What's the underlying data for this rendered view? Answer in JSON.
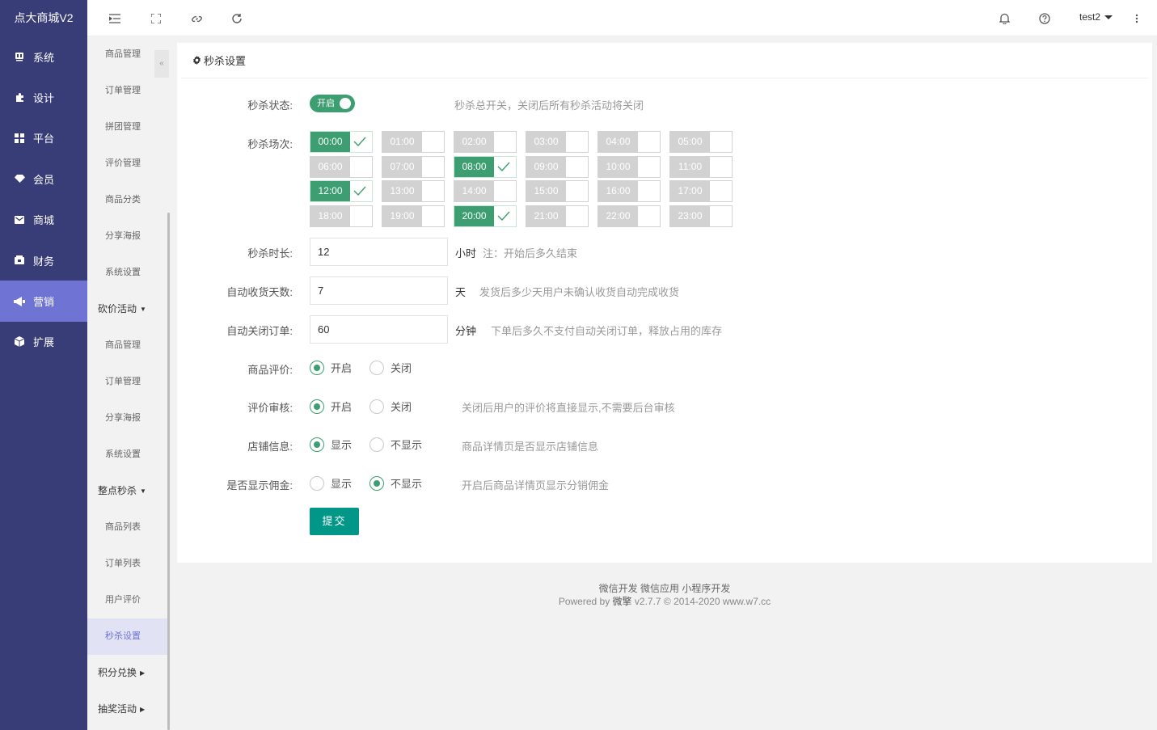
{
  "brand": "点大商城V2",
  "sidebar": {
    "items": [
      {
        "label": "系统",
        "icon": "monitor-icon"
      },
      {
        "label": "设计",
        "icon": "puzzle-icon"
      },
      {
        "label": "平台",
        "icon": "grid-icon"
      },
      {
        "label": "会员",
        "icon": "diamond-icon"
      },
      {
        "label": "商城",
        "icon": "mail-icon"
      },
      {
        "label": "财务",
        "icon": "wallet-icon"
      },
      {
        "label": "营销",
        "icon": "megaphone-icon",
        "active": true
      },
      {
        "label": "扩展",
        "icon": "cube-icon"
      }
    ]
  },
  "submenu": {
    "items": [
      "商品管理",
      "订单管理",
      "拼团管理",
      "评价管理",
      "商品分类",
      "分享海报",
      "系统设置"
    ],
    "group1": "砍价活动",
    "group1_items": [
      "商品管理",
      "订单管理",
      "分享海报",
      "系统设置"
    ],
    "group2": "整点秒杀",
    "group2_items": [
      "商品列表",
      "订单列表",
      "用户评价",
      "秒杀设置"
    ],
    "group3": "积分兑换",
    "group4": "抽奖活动"
  },
  "topbar": {
    "user": "test2",
    "collapse_glyph": "«"
  },
  "page": {
    "title": "秒杀设置"
  },
  "form": {
    "status_label": "秒杀状态:",
    "status_switch": "开启",
    "status_hint": "秒杀总开关，关闭后所有秒杀活动将关闭",
    "slots_label": "秒杀场次:",
    "slots": [
      {
        "time": "00:00",
        "on": true
      },
      {
        "time": "01:00",
        "on": false
      },
      {
        "time": "02:00",
        "on": false
      },
      {
        "time": "03:00",
        "on": false
      },
      {
        "time": "04:00",
        "on": false
      },
      {
        "time": "05:00",
        "on": false
      },
      {
        "time": "06:00",
        "on": false
      },
      {
        "time": "07:00",
        "on": false
      },
      {
        "time": "08:00",
        "on": true
      },
      {
        "time": "09:00",
        "on": false
      },
      {
        "time": "10:00",
        "on": false
      },
      {
        "time": "11:00",
        "on": false
      },
      {
        "time": "12:00",
        "on": true
      },
      {
        "time": "13:00",
        "on": false
      },
      {
        "time": "14:00",
        "on": false
      },
      {
        "time": "15:00",
        "on": false
      },
      {
        "time": "16:00",
        "on": false
      },
      {
        "time": "17:00",
        "on": false
      },
      {
        "time": "18:00",
        "on": false
      },
      {
        "time": "19:00",
        "on": false
      },
      {
        "time": "20:00",
        "on": true
      },
      {
        "time": "21:00",
        "on": false
      },
      {
        "time": "22:00",
        "on": false
      },
      {
        "time": "23:00",
        "on": false
      }
    ],
    "duration_label": "秒杀时长:",
    "duration_value": "12",
    "duration_unit": "小时",
    "duration_hint": "注：开始后多久结束",
    "receive_label": "自动收货天数:",
    "receive_value": "7",
    "receive_unit": "天",
    "receive_hint": "发货后多少天用户未确认收货自动完成收货",
    "close_label": "自动关闭订单:",
    "close_value": "60",
    "close_unit": "分钟",
    "close_hint": "下单后多久不支付自动关闭订单，释放占用的库存",
    "review_label": "商品评价:",
    "review_on": "开启",
    "review_off": "关闭",
    "audit_label": "评价审核:",
    "audit_on": "开启",
    "audit_off": "关闭",
    "audit_hint": "关闭后用户的评价将直接显示,不需要后台审核",
    "shop_label": "店铺信息:",
    "shop_show": "显示",
    "shop_hide": "不显示",
    "shop_hint": "商品详情页是否显示店铺信息",
    "commission_label": "是否显示佣金:",
    "commission_show": "显示",
    "commission_hide": "不显示",
    "commission_hint": "开启后商品详情页显示分销佣金",
    "submit": "提交"
  },
  "footer": {
    "links": "微信开发 微信应用 小程序开发",
    "powered_prefix": "Powered by",
    "powered_brand": "微擎",
    "powered_suffix": "v2.7.7 © 2014-2020 www.w7.cc"
  },
  "colors": {
    "sidebar": "#393d77",
    "sidebar_active": "#6f73d4",
    "accent_green": "#3c9e71",
    "submit": "#009688"
  }
}
